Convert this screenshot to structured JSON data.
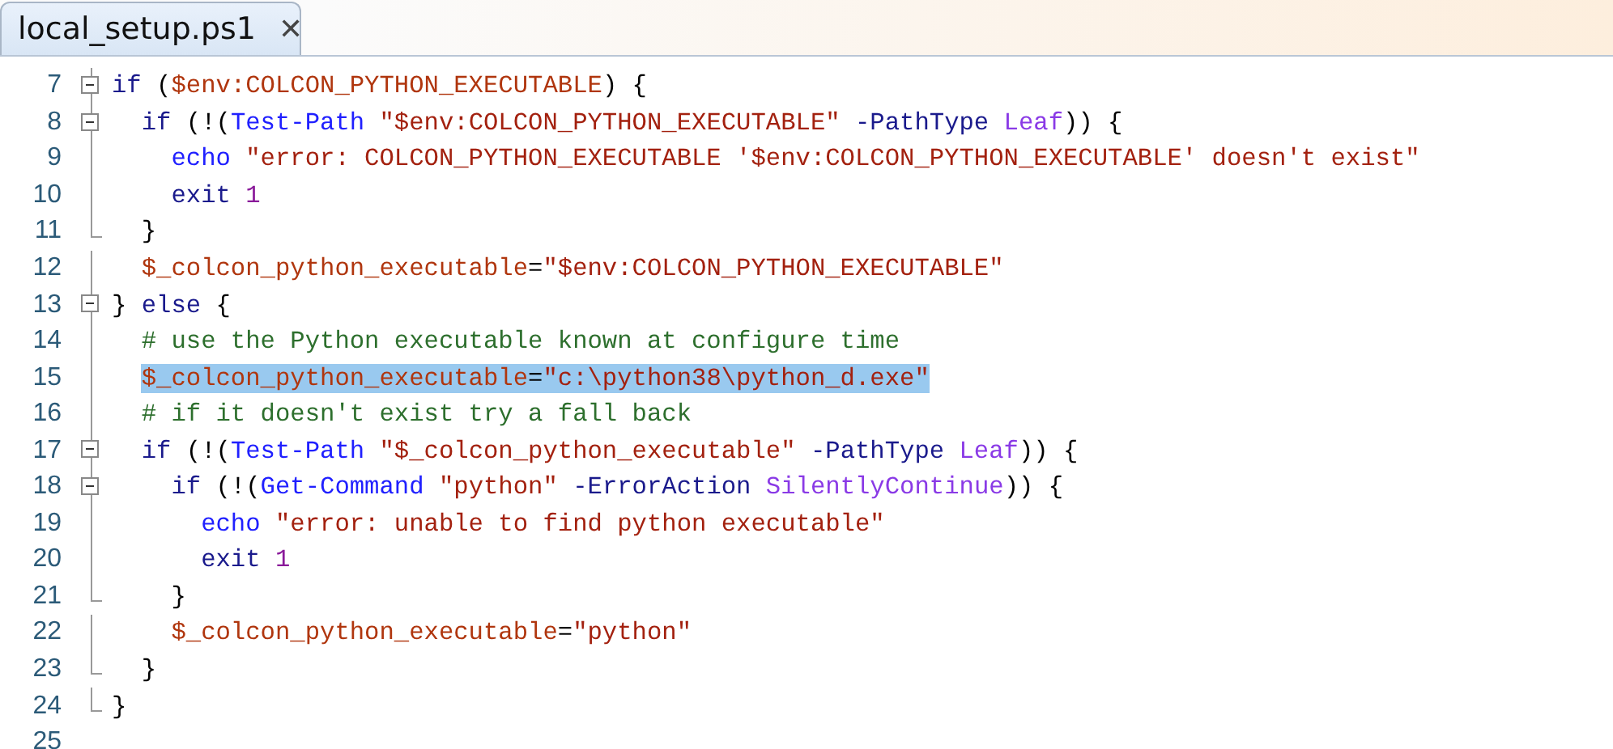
{
  "tab": {
    "title": "local_setup.ps1",
    "close": "✕",
    "selected": true
  },
  "lines": [
    {
      "number": "7",
      "kind": "block-start",
      "selected": false,
      "tokens": [
        {
          "kind": "keyword",
          "text": "if"
        },
        {
          "kind": "plain",
          "text": " ("
        },
        {
          "kind": "variable",
          "text": "$env:COLCON_PYTHON_EXECUTABLE"
        },
        {
          "kind": "plain",
          "text": ") {"
        }
      ]
    },
    {
      "number": "8",
      "kind": "block-start",
      "selected": false,
      "tokens": [
        {
          "kind": "keyword",
          "text": "  if"
        },
        {
          "kind": "plain",
          "text": " (!("
        },
        {
          "kind": "cmdlet",
          "text": "Test-Path"
        },
        {
          "kind": "string",
          "text": " \"$env:COLCON_PYTHON_EXECUTABLE\""
        },
        {
          "kind": "param",
          "text": " -PathType"
        },
        {
          "kind": "enum",
          "text": " Leaf"
        },
        {
          "kind": "plain",
          "text": ")) {"
        }
      ]
    },
    {
      "number": "9",
      "kind": "inside",
      "selected": false,
      "tokens": [
        {
          "kind": "cmdlet",
          "text": "    echo"
        },
        {
          "kind": "string",
          "text": " \"error: COLCON_PYTHON_EXECUTABLE '$env:COLCON_PYTHON_EXECUTABLE' doesn't exist\""
        }
      ]
    },
    {
      "number": "10",
      "kind": "inside",
      "selected": false,
      "tokens": [
        {
          "kind": "keyword",
          "text": "    exit"
        },
        {
          "kind": "number",
          "text": " 1"
        }
      ]
    },
    {
      "number": "11",
      "kind": "block-end",
      "selected": false,
      "tokens": [
        {
          "kind": "plain",
          "text": "  }"
        }
      ]
    },
    {
      "number": "12",
      "kind": "inside",
      "selected": false,
      "tokens": [
        {
          "kind": "variable",
          "text": "  $_colcon_python_executable"
        },
        {
          "kind": "plain",
          "text": "="
        },
        {
          "kind": "string",
          "text": "\"$env:COLCON_PYTHON_EXECUTABLE\""
        }
      ]
    },
    {
      "number": "13",
      "kind": "block-start",
      "selected": false,
      "tokens": [
        {
          "kind": "plain",
          "text": "} "
        },
        {
          "kind": "keyword",
          "text": "else"
        },
        {
          "kind": "plain",
          "text": " {"
        }
      ]
    },
    {
      "number": "14",
      "kind": "inside",
      "selected": false,
      "tokens": [
        {
          "kind": "comment",
          "text": "  # use the Python executable known at configure time"
        }
      ]
    },
    {
      "number": "15",
      "kind": "inside",
      "selected": true,
      "tokens": [
        {
          "kind": "variable",
          "text": "  $_colcon_python_executable"
        },
        {
          "kind": "plain",
          "text": "="
        },
        {
          "kind": "string",
          "text": "\"c:\\python38\\python_d.exe\""
        }
      ]
    },
    {
      "number": "16",
      "kind": "inside",
      "selected": false,
      "tokens": [
        {
          "kind": "comment",
          "text": "  # if it doesn't exist try a fall back"
        }
      ]
    },
    {
      "number": "17",
      "kind": "block-start",
      "selected": false,
      "tokens": [
        {
          "kind": "keyword",
          "text": "  if"
        },
        {
          "kind": "plain",
          "text": " (!("
        },
        {
          "kind": "cmdlet",
          "text": "Test-Path"
        },
        {
          "kind": "string",
          "text": " \"$_colcon_python_executable\""
        },
        {
          "kind": "param",
          "text": " -PathType"
        },
        {
          "kind": "enum",
          "text": " Leaf"
        },
        {
          "kind": "plain",
          "text": ")) {"
        }
      ]
    },
    {
      "number": "18",
      "kind": "block-start",
      "selected": false,
      "tokens": [
        {
          "kind": "keyword",
          "text": "    if"
        },
        {
          "kind": "plain",
          "text": " (!("
        },
        {
          "kind": "cmdlet",
          "text": "Get-Command"
        },
        {
          "kind": "string",
          "text": " \"python\""
        },
        {
          "kind": "param",
          "text": " -ErrorAction"
        },
        {
          "kind": "enum",
          "text": " SilentlyContinue"
        },
        {
          "kind": "plain",
          "text": ")) {"
        }
      ]
    },
    {
      "number": "19",
      "kind": "inside",
      "selected": false,
      "tokens": [
        {
          "kind": "cmdlet",
          "text": "      echo"
        },
        {
          "kind": "string",
          "text": " \"error: unable to find python executable\""
        }
      ]
    },
    {
      "number": "20",
      "kind": "inside",
      "selected": false,
      "tokens": [
        {
          "kind": "keyword",
          "text": "      exit"
        },
        {
          "kind": "number",
          "text": " 1"
        }
      ]
    },
    {
      "number": "21",
      "kind": "block-end",
      "selected": false,
      "tokens": [
        {
          "kind": "plain",
          "text": "    }"
        }
      ]
    },
    {
      "number": "22",
      "kind": "inside",
      "selected": false,
      "tokens": [
        {
          "kind": "variable",
          "text": "    $_colcon_python_executable"
        },
        {
          "kind": "plain",
          "text": "="
        },
        {
          "kind": "string",
          "text": "\"python\""
        }
      ]
    },
    {
      "number": "23",
      "kind": "block-end",
      "selected": false,
      "tokens": [
        {
          "kind": "plain",
          "text": "  }"
        }
      ]
    },
    {
      "number": "24",
      "kind": "block-end",
      "selected": false,
      "tokens": [
        {
          "kind": "plain",
          "text": "}"
        }
      ]
    },
    {
      "number": "25",
      "kind": "plain",
      "selected": false
    }
  ]
}
